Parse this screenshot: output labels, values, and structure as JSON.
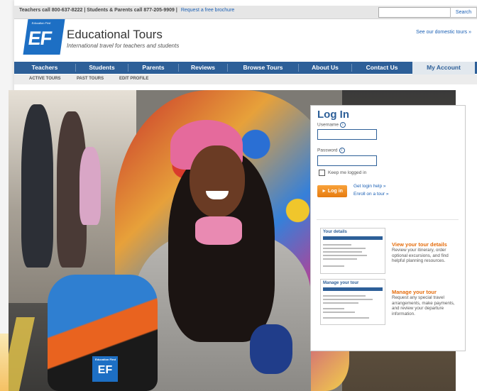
{
  "topbar": {
    "contact_text": "Teachers call 800-637-8222 | Students & Parents call 877-205-9909 |",
    "brochure_link": "Request a free brochure",
    "search_button": "Search",
    "search_placeholder": ""
  },
  "header": {
    "logo_small": "Education First",
    "logo_big": "EF",
    "title": "Educational Tours",
    "tagline": "International travel for teachers and students",
    "domestic_link": "See our domestic tours »"
  },
  "nav": {
    "tabs": [
      "Teachers",
      "Students",
      "Parents",
      "Reviews",
      "Browse Tours",
      "About Us",
      "Contact Us",
      "My Account"
    ],
    "active_index": 7
  },
  "subnav": {
    "items": [
      "ACTIVE TOURS",
      "PAST TOURS",
      "EDIT PROFILE"
    ]
  },
  "login": {
    "title": "Log In",
    "username_label": "Username",
    "password_label": "Password",
    "username_value": "",
    "password_value": "",
    "remember_label": "Keep me logged in",
    "button_label": "► Log in",
    "help_link": "Get login help »",
    "enroll_link": "Enroll on a tour »"
  },
  "features": [
    {
      "thumb_title": "Your details",
      "title": "View your tour details",
      "description": "Review your itinerary, order optional excursions, and find helpful planning resources."
    },
    {
      "thumb_title": "Manage your tour",
      "title": "Manage your tour",
      "description": "Request any special travel arrangements, make payments, and review your departure information."
    }
  ],
  "colors": {
    "nav_blue": "#2d5f98",
    "link_blue": "#1a5fb4",
    "accent_orange": "#e67b10",
    "logo_blue": "#1d6fc4"
  },
  "backpack_logo": {
    "small": "Education First",
    "big": "EF"
  }
}
